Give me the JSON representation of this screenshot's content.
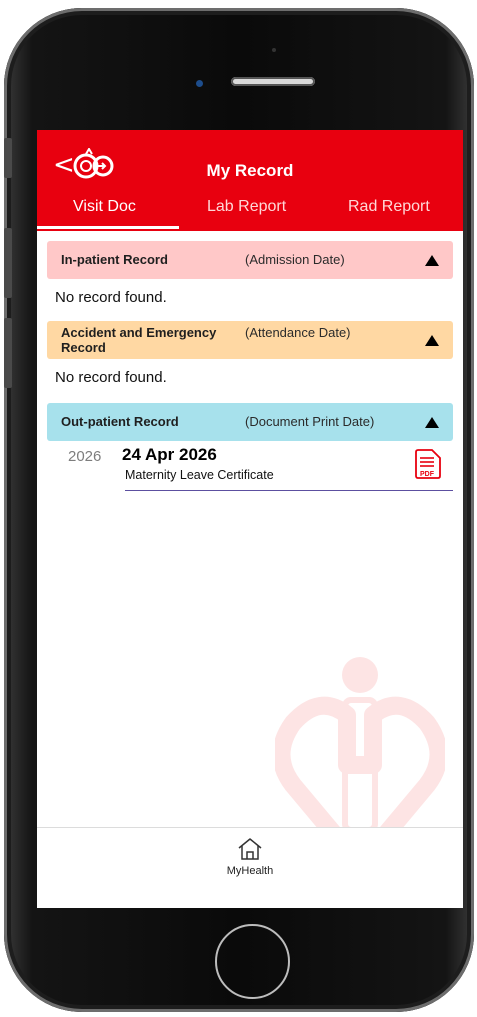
{
  "header": {
    "title": "My Record",
    "back_glyph": "<",
    "logo_icon": "hospital-authority-go-logo",
    "accent_color": "#e8000f"
  },
  "tabs": [
    {
      "label": "Visit Doc",
      "active": true
    },
    {
      "label": "Lab Report",
      "active": false
    },
    {
      "label": "Rad Report",
      "active": false
    }
  ],
  "sections": {
    "inpatient": {
      "label": "In-patient Record",
      "date_label": "(Admission Date)",
      "empty_text": "No record found.",
      "color": "#ffc8c8"
    },
    "ae": {
      "label": "Accident and Emergency Record",
      "date_label": "(Attendance Date)",
      "empty_text": "No record found.",
      "color": "#ffd8a3"
    },
    "outpatient": {
      "label": "Out-patient Record",
      "date_label": "(Document Print Date)",
      "color": "#a7e1ec"
    }
  },
  "records": [
    {
      "year": "2026",
      "date": "24 Apr 2026",
      "description": "Maternity Leave Certificate",
      "file_icon": "pdf-icon",
      "file_badge": "PDF"
    }
  ],
  "bottom_nav": {
    "label": "MyHealth",
    "icon": "home-icon"
  }
}
